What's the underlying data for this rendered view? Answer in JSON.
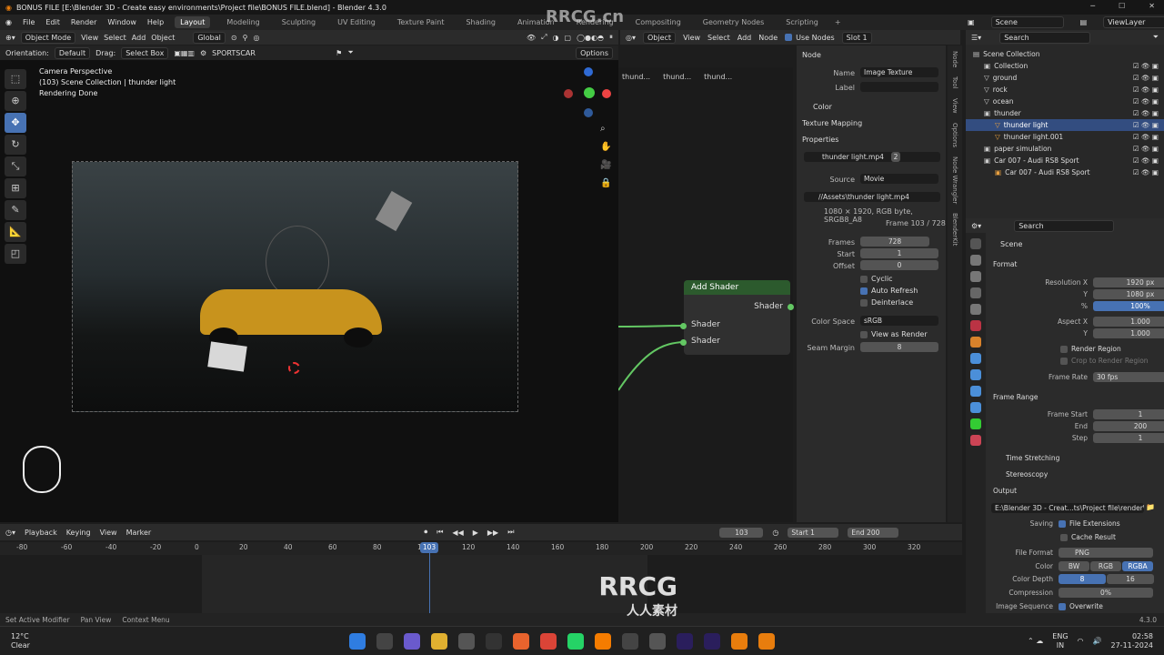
{
  "title": "BONUS FILE [E:\\Blender 3D - Create easy environments\\Project file\\BONUS FILE.blend] - Blender 4.3.0",
  "menu": [
    "File",
    "Edit",
    "Render",
    "Window",
    "Help"
  ],
  "workspaces": [
    "Layout",
    "Modeling",
    "Sculpting",
    "UV Editing",
    "Texture Paint",
    "Shading",
    "Animation",
    "Rendering",
    "Compositing",
    "Geometry Nodes",
    "Scripting"
  ],
  "scene": "Scene",
  "viewlayer": "ViewLayer",
  "viewport": {
    "mode": "Object Mode",
    "menus": [
      "View",
      "Select",
      "Add",
      "Object"
    ],
    "orientation_label": "Orientation:",
    "orientation": "Default",
    "drag_label": "Drag:",
    "drag": "Select Box",
    "transform": "Global",
    "obj_name": "SPORTSCAR",
    "options": "Options",
    "overlay": [
      "Camera Perspective",
      "(103) Scene Collection | thunder light",
      "Rendering Done"
    ]
  },
  "node_editor": {
    "type": "Object",
    "menus": [
      "View",
      "Select",
      "Add",
      "Node"
    ],
    "use_nodes": "Use Nodes",
    "slot": "Slot 1",
    "breadcrumbs": [
      "thund...",
      "thund...",
      "thund..."
    ],
    "node": {
      "title": "Add Shader",
      "output": "Shader",
      "inputs": [
        "Shader",
        "Shader"
      ]
    }
  },
  "npanel": {
    "node_header": "Node",
    "name_label": "Name",
    "name": "Image Texture",
    "label_label": "Label",
    "color": "Color",
    "texture_mapping": "Texture Mapping",
    "properties": "Properties",
    "image": "thunder light.mp4",
    "users": "2",
    "source_label": "Source",
    "source": "Movie",
    "path": "//Assets\\thunder light.mp4",
    "info": "1080 × 1920, RGB byte, SRGB8_A8",
    "frame_info": "Frame 103 / 728",
    "frames_label": "Frames",
    "frames": "728",
    "start_label": "Start",
    "start": "1",
    "offset_label": "Offset",
    "offset": "0",
    "cyclic": "Cyclic",
    "auto_refresh": "Auto Refresh",
    "deinterlace": "Deinterlace",
    "colorspace_label": "Color Space",
    "colorspace": "sRGB",
    "view_as_render": "View as Render",
    "seam_label": "Seam Margin",
    "seam": "8",
    "tabs": [
      "Node",
      "Tool",
      "View",
      "Options",
      "Node Wrangler",
      "BlenderKit"
    ]
  },
  "outliner": {
    "search": "Search",
    "items": [
      {
        "label": "Scene Collection",
        "indent": 0
      },
      {
        "label": "Collection",
        "indent": 1
      },
      {
        "label": "ground",
        "indent": 1
      },
      {
        "label": "rock",
        "indent": 1
      },
      {
        "label": "ocean",
        "indent": 1
      },
      {
        "label": "thunder",
        "indent": 1
      },
      {
        "label": "thunder light",
        "indent": 2,
        "selected": true
      },
      {
        "label": "thunder light.001",
        "indent": 2
      },
      {
        "label": "paper simulation",
        "indent": 1
      },
      {
        "label": "Car 007 - Audi RS8 Sport",
        "indent": 1
      },
      {
        "label": "Car 007 - Audi RS8 Sport",
        "indent": 2
      }
    ]
  },
  "props": {
    "search": "Search",
    "scene": "Scene",
    "format": "Format",
    "resx_label": "Resolution X",
    "resx": "1920 px",
    "resy_label": "Y",
    "resy": "1080 px",
    "pct_label": "%",
    "pct": "100%",
    "aspx_label": "Aspect X",
    "aspx": "1.000",
    "aspy_label": "Y",
    "aspy": "1.000",
    "render_region": "Render Region",
    "crop": "Crop to Render Region",
    "fps_label": "Frame Rate",
    "fps": "30 fps",
    "frame_range": "Frame Range",
    "fstart_label": "Frame Start",
    "fstart": "1",
    "fend_label": "End",
    "fend": "200",
    "fstep_label": "Step",
    "fstep": "1",
    "time_stretching": "Time Stretching",
    "stereoscopy": "Stereoscopy",
    "output": "Output",
    "out_path": "E:\\Blender 3D - Creat...ts\\Project file\\render\\",
    "saving_label": "Saving",
    "file_ext": "File Extensions",
    "cache": "Cache Result",
    "ff_label": "File Format",
    "ff": "PNG",
    "color_label": "Color",
    "color_opts": [
      "BW",
      "RGB",
      "RGBA"
    ],
    "depth_label": "Color Depth",
    "depth_opts": [
      "8",
      "16"
    ],
    "comp_label": "Compression",
    "comp": "0%",
    "imgseq_label": "Image Sequence",
    "overwrite": "Overwrite"
  },
  "timeline": {
    "menus": [
      "Playback",
      "Keying",
      "View",
      "Marker"
    ],
    "current": "103",
    "start_label": "Start",
    "start": "1",
    "end_label": "End",
    "end": "200",
    "ticks": [
      "-80",
      "-60",
      "-40",
      "-20",
      "0",
      "20",
      "40",
      "60",
      "80",
      "100",
      "120",
      "140",
      "160",
      "180",
      "200",
      "220",
      "240",
      "260",
      "280",
      "300",
      "320"
    ]
  },
  "status": [
    "Set Active Modifier",
    "Pan View",
    "Context Menu"
  ],
  "version": "4.3.0",
  "taskbar": {
    "temp": "12°C",
    "weather": "Clear",
    "lang": "ENG",
    "lang2": "IN",
    "time": "02:58",
    "date": "27-11-2024"
  },
  "watermark": [
    "RRCG.cn",
    "RRCG",
    "人人素材"
  ]
}
